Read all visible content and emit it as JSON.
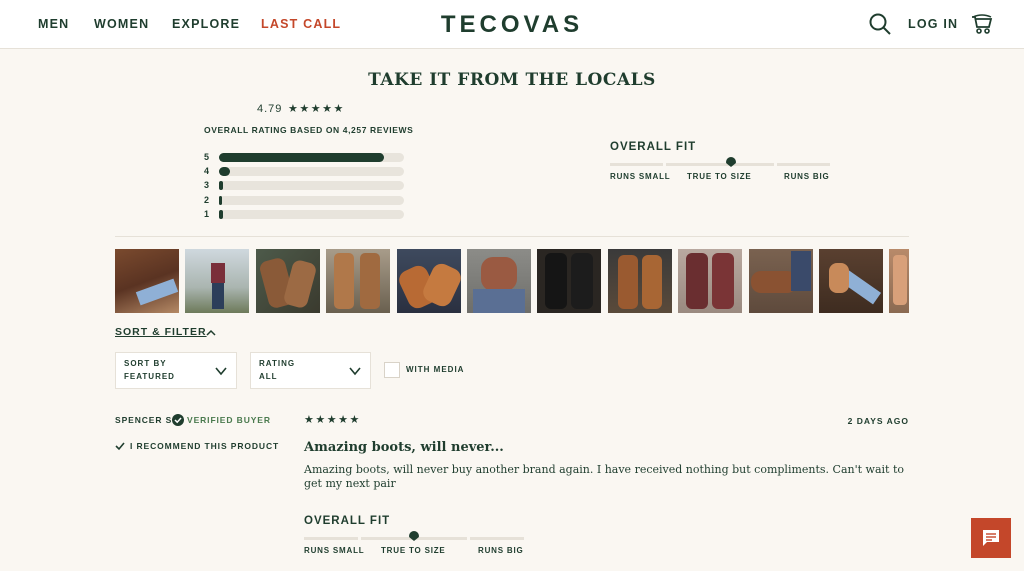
{
  "nav": {
    "links": [
      "MEN",
      "WOMEN",
      "EXPLORE",
      "LAST CALL"
    ],
    "logo": "TECOVAS",
    "login": "LOG IN",
    "icons": [
      "search-icon",
      "cart-icon"
    ]
  },
  "reviews_summary": {
    "title": "TAKE IT FROM THE LOCALS",
    "average": "4.79",
    "average_stars": "★★★★★",
    "caption": "OVERALL RATING BASED ON 4,257 REVIEWS",
    "distribution": [
      {
        "label": "5",
        "fraction": 0.89
      },
      {
        "label": "4",
        "fraction": 0.06
      },
      {
        "label": "3",
        "fraction": 0.02
      },
      {
        "label": "2",
        "fraction": 0.01
      },
      {
        "label": "1",
        "fraction": 0.02
      }
    ],
    "fit": {
      "title": "OVERALL FIT",
      "labels": [
        "RUNS SMALL",
        "TRUE TO SIZE",
        "RUNS BIG"
      ],
      "position": 0.55
    }
  },
  "photos": {
    "count_visible": 12,
    "alt": "Customer photo"
  },
  "filters": {
    "toggle_label": "SORT & FILTER",
    "sort": {
      "label": "SORT BY",
      "value": "FEATURED"
    },
    "rating": {
      "label": "RATING",
      "value": "ALL"
    },
    "media_label": "WITH MEDIA"
  },
  "review": {
    "reviewer": "SPENCER S",
    "verified": "VERIFIED BUYER",
    "recommend": "I RECOMMEND THIS PRODUCT",
    "stars": "★★★★★",
    "date": "2 DAYS AGO",
    "title": "Amazing boots, will never...",
    "body": "Amazing boots, will never buy another brand again. I have received nothing but compliments. Can't wait to get my next pair",
    "fit": {
      "title": "OVERALL FIT",
      "labels": [
        "RUNS SMALL",
        "TRUE TO SIZE",
        "RUNS BIG"
      ],
      "position": 0.5
    }
  },
  "colors": {
    "brand": "#1f3d2e",
    "accent": "#c4472a",
    "background": "#faf7f2"
  }
}
